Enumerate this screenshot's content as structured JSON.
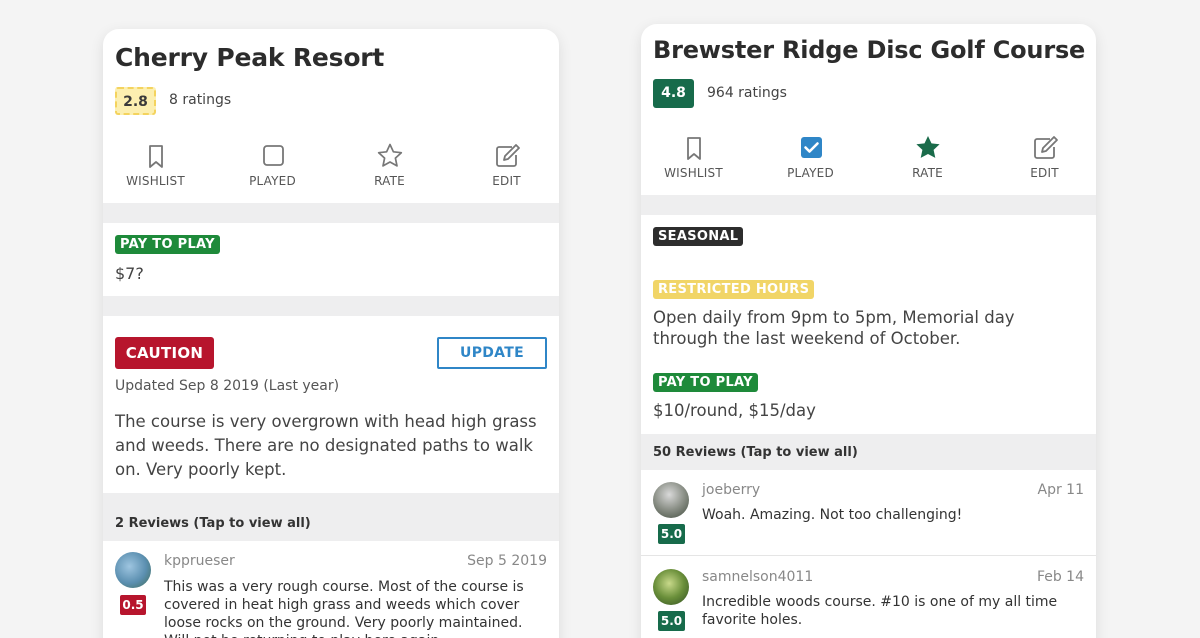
{
  "cards": [
    {
      "title": "Cherry Peak Resort",
      "rating": "2.8",
      "rating_count": "8 ratings",
      "actions": {
        "wishlist": "WISHLIST",
        "played": "PLAYED",
        "rate": "RATE",
        "edit": "EDIT"
      },
      "pay_to_play": {
        "label": "PAY TO PLAY",
        "price": "$7?"
      },
      "caution": {
        "label": "CAUTION",
        "update_button": "UPDATE",
        "updated": "Updated Sep 8 2019 (Last year)",
        "text": "The course is very overgrown with head high grass and weeds. There are no designated paths to walk on. Very poorly kept."
      },
      "reviews_header": "2 Reviews (Tap to view all)",
      "reviews": [
        {
          "user": "kpprueser",
          "date": "Sep 5 2019",
          "score": "0.5",
          "text": "This was a very rough course. Most of the course is covered in heat high grass and weeds which cover loose rocks on the ground. Very poorly maintained. Will not be returning to play here again."
        }
      ]
    },
    {
      "title": "Brewster Ridge Disc Golf Course",
      "rating": "4.8",
      "rating_count": "964 ratings",
      "actions": {
        "wishlist": "WISHLIST",
        "played": "PLAYED",
        "rate": "RATE",
        "edit": "EDIT"
      },
      "seasonal_label": "SEASONAL",
      "restricted": {
        "label": "RESTRICTED HOURS",
        "text": "Open daily from 9pm to 5pm,  Memorial day through the last weekend of October."
      },
      "pay_to_play": {
        "label": "PAY TO PLAY",
        "price": "$10/round, $15/day"
      },
      "reviews_header": "50 Reviews (Tap to view all)",
      "reviews": [
        {
          "user": "joeberry",
          "date": "Apr 11",
          "score": "5.0",
          "text": "Woah. Amazing. Not too challenging!"
        },
        {
          "user": "samnelson4011",
          "date": "Feb 14",
          "score": "5.0",
          "text": "Incredible woods course. #10 is one of my all time favorite holes."
        }
      ]
    }
  ],
  "colors": {
    "green": "#1e8a3a",
    "dark_green": "#176b4b",
    "caution_red": "#b7152d",
    "update_blue": "#2f86c7",
    "restricted_yellow": "#f1d567",
    "rating_yellow": "#fcefb0",
    "played_check_blue": "#2f86c7",
    "star_green": "#1a6b4a"
  },
  "icons": {
    "wishlist": "bookmark-icon",
    "played_unchecked": "checkbox-empty-icon",
    "played_checked": "checkbox-checked-icon",
    "rate_empty": "star-outline-icon",
    "rate_filled": "star-filled-icon",
    "edit": "edit-icon"
  }
}
